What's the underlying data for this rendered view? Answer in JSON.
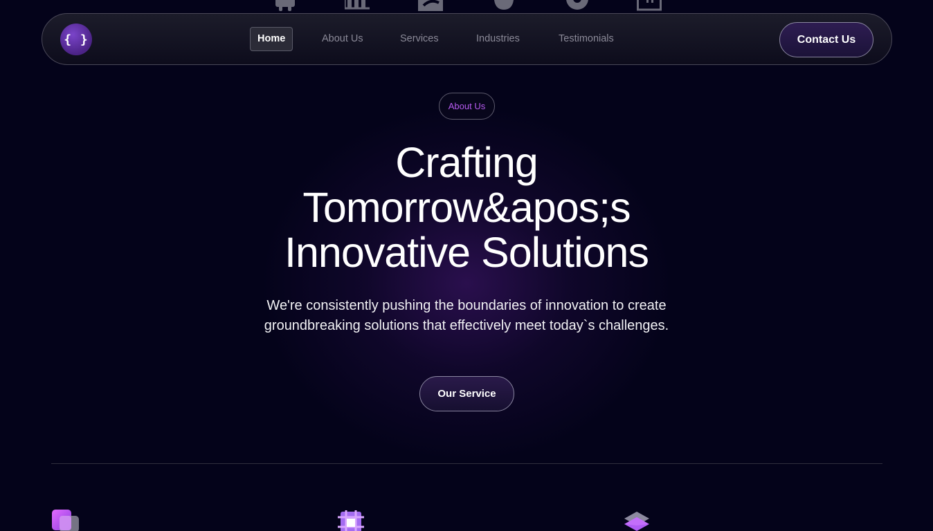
{
  "top_icons": [
    "android-icon",
    "server-icon",
    "internet-explorer-icon",
    "apple-icon",
    "chrome-icon",
    "typescript-icon"
  ],
  "nav": {
    "logo_text": "{ }",
    "links": [
      {
        "label": "Home",
        "active": true
      },
      {
        "label": "About Us",
        "active": false
      },
      {
        "label": "Services",
        "active": false
      },
      {
        "label": "Industries",
        "active": false
      },
      {
        "label": "Testimonials",
        "active": false
      }
    ],
    "contact_label": "Contact Us"
  },
  "hero": {
    "pill_label": "About Us",
    "title_lines": [
      "Crafting",
      "Tomorrow&apos;s",
      "Innovative Solutions"
    ],
    "subtitle": "We're consistently pushing the boundaries of innovation to create groundbreaking solutions that effectively meet today`s challenges.",
    "button_label": "Our Service"
  },
  "features": {
    "icons": [
      "stacked-squares-icon",
      "chip-grid-icon",
      "layers-icon"
    ]
  },
  "colors": {
    "background": "#04031a",
    "accent_purple": "#b65bf0",
    "logo_purple": "#5a2a9a",
    "nav_muted_text": "#8b8a98"
  }
}
